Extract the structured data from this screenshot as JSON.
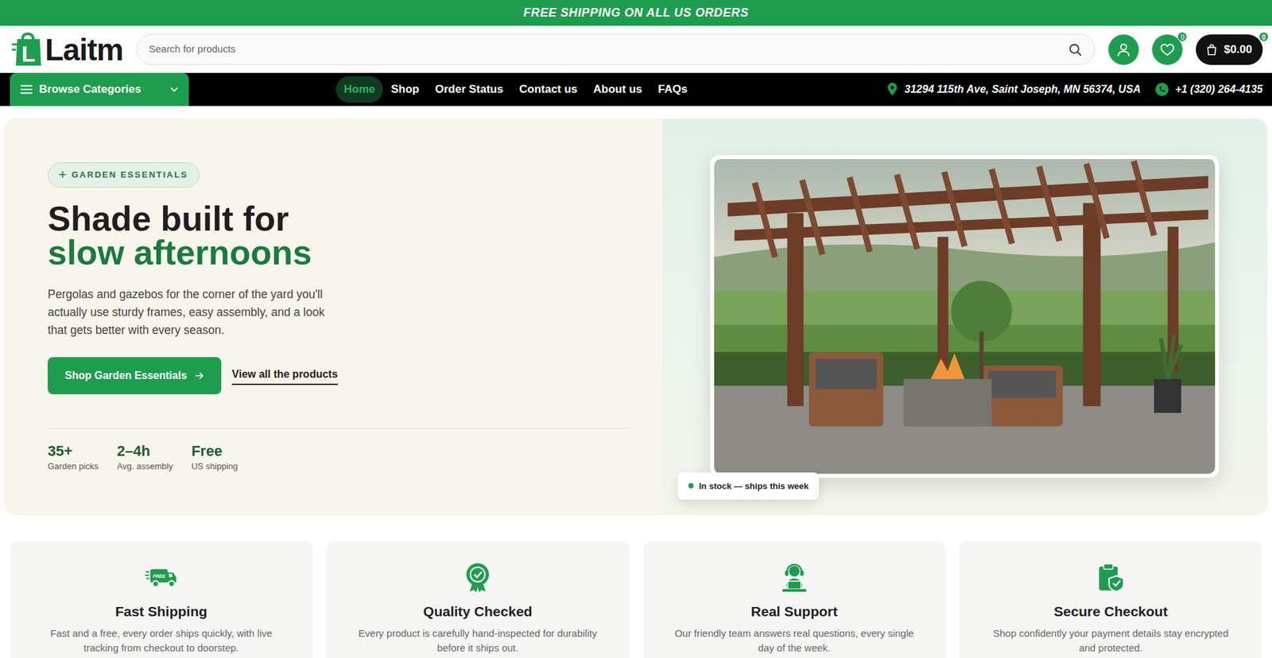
{
  "announcement": "FREE SHIPPING ON ALL US ORDERS",
  "logo": {
    "mark": "L",
    "name": "Laitm"
  },
  "search": {
    "placeholder": "Search for products"
  },
  "wishlist": {
    "count": "0"
  },
  "cart": {
    "total": "$0.00",
    "count": "0"
  },
  "categories": {
    "label": "Browse Categories"
  },
  "nav": [
    {
      "label": "Home",
      "selected": true
    },
    {
      "label": "Shop",
      "selected": false
    },
    {
      "label": "Order Status",
      "selected": false
    },
    {
      "label": "Contact us",
      "selected": false
    },
    {
      "label": "About us",
      "selected": false
    },
    {
      "label": "FAQs",
      "selected": false
    }
  ],
  "contact": {
    "address": "31294 115th Ave, Saint Joseph, MN 56374, USA",
    "phone": "+1 (320) 264-4135"
  },
  "hero": {
    "badge": "GARDEN ESSENTIALS",
    "title_line1": "Shade built for",
    "title_line2": "slow afternoons",
    "text": "Pergolas and gazebos for the corner of the yard you'll actually use sturdy frames, easy assembly, and a look that gets better with every season.",
    "primary_button": "Shop Garden Essentials",
    "secondary_link": "View all the products",
    "stats": [
      {
        "value": "35+",
        "label": "Garden picks"
      },
      {
        "value": "2–4h",
        "label": "Avg. assembly"
      },
      {
        "value": "Free",
        "label": "US shipping"
      }
    ],
    "stock": {
      "label": "In stock — ships this week",
      "in_stock": true
    }
  },
  "features": [
    {
      "icon_text": "FREE",
      "title": "Fast Shipping",
      "text": "Fast and a free, every order ships quickly, with live tracking from checkout to doorstep."
    },
    {
      "title": "Quality Checked",
      "text": "Every product is carefully hand-inspected for durability before it ships out."
    },
    {
      "title": "Real Support",
      "text": "Our friendly team answers real questions, every single day of the week."
    },
    {
      "title": "Secure Checkout",
      "text": "Shop confidently your payment details stay encrypted and protected."
    }
  ]
}
